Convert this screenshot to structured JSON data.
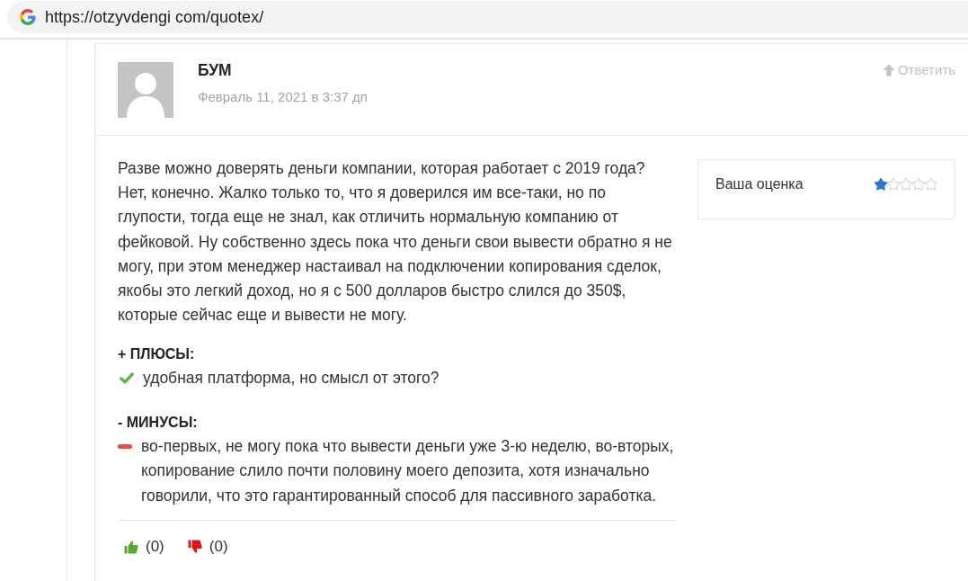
{
  "browser": {
    "url": "https://otzyvdengi com/quotex/"
  },
  "comment": {
    "author": "БУМ",
    "date": "Февраль 11, 2021 в 3:37 дп",
    "reply_link": "Ответить",
    "text": "Разве можно доверять деньги компании, которая работает с 2019 года? Нет, конечно. Жалко только то, что я доверился им все-таки, но по глупости, тогда еще не знал, как отличить нормальную компанию от фейковой. Ну собственно здесь пока что деньги свои вывести обратно я не могу, при этом менеджер настаивал на подключении копирования сделок, якобы это легкий доход, но я с 500 долларов быстро слился до 350$, которые сейчас еще и вывести не могу.",
    "rating": {
      "label": "Ваша оценка",
      "stars": 1
    },
    "sections": [
      {
        "kind": "pros",
        "heading": "+ ПЛЮСЫ:",
        "items": [
          "удобная платформа, но смысл от этого?"
        ]
      },
      {
        "kind": "cons",
        "heading": "- МИНУСЫ:",
        "items": [
          "во-первых, не могу пока что вывести деньги уже 3-ю неделю, во-вторых, копирование слило почти половину моего депозита, хотя изначально говорили, что это гарантированный способ для пассивного заработка."
        ]
      }
    ],
    "votes": [
      {
        "kind": "up",
        "count": "(0)"
      },
      {
        "kind": "down",
        "count": "(0)"
      }
    ]
  }
}
